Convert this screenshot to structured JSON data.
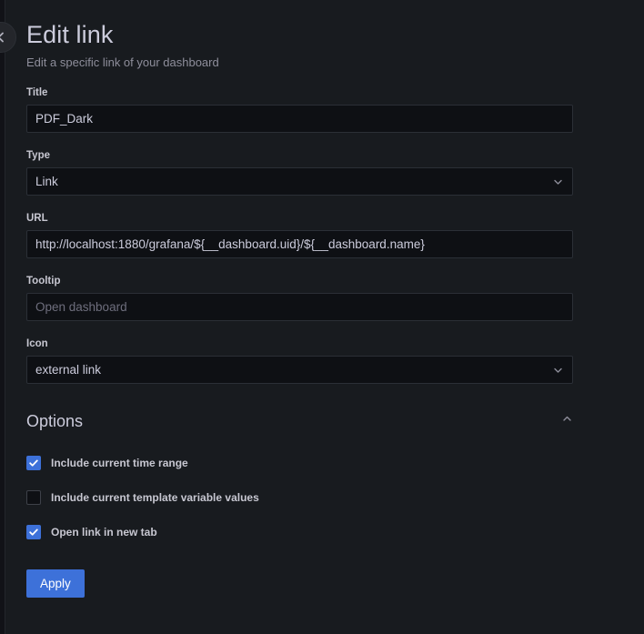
{
  "header": {
    "title": "Edit link",
    "subtitle": "Edit a specific link of your dashboard",
    "collapse_icon": "chevron-left-icon"
  },
  "fields": {
    "title": {
      "label": "Title",
      "value": "PDF_Dark"
    },
    "type": {
      "label": "Type",
      "value": "Link",
      "icon": "chevron-down-icon"
    },
    "url": {
      "label": "URL",
      "value": "http://localhost:1880/grafana/${__dashboard.uid}/${__dashboard.name}"
    },
    "tooltip": {
      "label": "Tooltip",
      "value": "",
      "placeholder": "Open dashboard"
    },
    "icon": {
      "label": "Icon",
      "value": "external link",
      "icon": "chevron-down-icon"
    }
  },
  "options": {
    "title": "Options",
    "collapse_icon": "chevron-up-icon",
    "checkboxes": [
      {
        "label": "Include current time range",
        "checked": true
      },
      {
        "label": "Include current template variable values",
        "checked": false
      },
      {
        "label": "Open link in new tab",
        "checked": true
      }
    ]
  },
  "actions": {
    "apply_label": "Apply"
  },
  "colors": {
    "accent": "#3d71d9",
    "panel_bg": "#181b1f",
    "input_bg": "#0e1014",
    "text_primary": "#ccccdc",
    "text_secondary": "#8e8e9b"
  }
}
